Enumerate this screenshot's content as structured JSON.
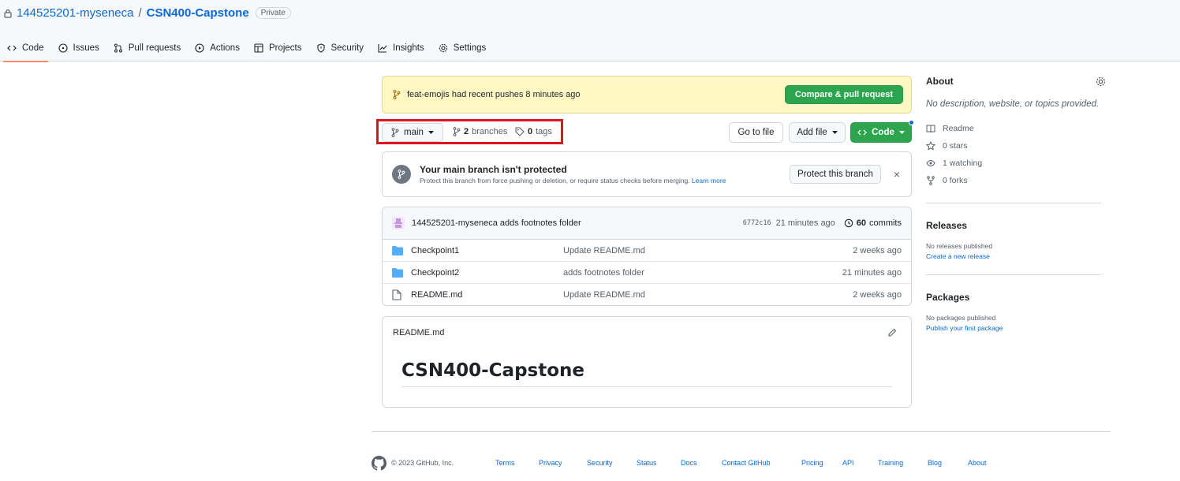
{
  "repo": {
    "owner": "144525201-myseneca",
    "separator": "/",
    "name": "CSN400-Capstone",
    "visibility": "Private"
  },
  "tabs": [
    {
      "label": "Code",
      "icon": "code-icon",
      "active": true
    },
    {
      "label": "Issues",
      "icon": "issue-icon"
    },
    {
      "label": "Pull requests",
      "icon": "pull-request-icon"
    },
    {
      "label": "Actions",
      "icon": "play-icon"
    },
    {
      "label": "Projects",
      "icon": "table-icon"
    },
    {
      "label": "Security",
      "icon": "shield-icon"
    },
    {
      "label": "Insights",
      "icon": "graph-icon"
    },
    {
      "label": "Settings",
      "icon": "gear-icon"
    }
  ],
  "flash": {
    "branch": "feat-emojis",
    "message": "had recent pushes 8 minutes ago",
    "button": "Compare & pull request"
  },
  "branch_bar": {
    "current_branch": "main",
    "branches_count": "2",
    "branches_label": "branches",
    "tags_count": "0",
    "tags_label": "tags",
    "goto_file": "Go to file",
    "add_file": "Add file",
    "code": "Code"
  },
  "protect": {
    "title": "Your main branch isn't protected",
    "subtitle": "Protect this branch from force pushing or deletion, or require status checks before merging.",
    "learn_more": "Learn more",
    "button": "Protect this branch",
    "close": "×"
  },
  "latest_commit": {
    "message": "144525201-myseneca adds footnotes folder",
    "sha": "6772c16",
    "time": "21 minutes ago",
    "commits_count": "60",
    "commits_label": "commits"
  },
  "files": [
    {
      "name": "Checkpoint1",
      "type": "folder",
      "message": "Update README.md",
      "age": "2 weeks ago"
    },
    {
      "name": "Checkpoint2",
      "type": "folder",
      "message": "adds footnotes folder",
      "age": "21 minutes ago"
    },
    {
      "name": "README.md",
      "type": "file",
      "message": "Update README.md",
      "age": "2 weeks ago"
    }
  ],
  "readme": {
    "filename": "README.md",
    "heading": "CSN400-Capstone"
  },
  "about": {
    "title": "About",
    "description": "No description, website, or topics provided.",
    "items": [
      {
        "icon": "book-icon",
        "label": "Readme"
      },
      {
        "icon": "star-icon",
        "label": "0 stars"
      },
      {
        "icon": "eye-icon",
        "label": "1 watching"
      },
      {
        "icon": "fork-icon",
        "label": "0 forks"
      }
    ]
  },
  "releases": {
    "title": "Releases",
    "empty": "No releases published",
    "link": "Create a new release"
  },
  "packages": {
    "title": "Packages",
    "empty": "No packages published",
    "link": "Publish your first package"
  },
  "footer": {
    "copyright": "© 2023 GitHub, Inc.",
    "links": [
      "Terms",
      "Privacy",
      "Security",
      "Status",
      "Docs",
      "Contact GitHub",
      "Pricing",
      "API",
      "Training",
      "Blog",
      "About"
    ]
  },
  "colors": {
    "link": "#0969da",
    "green": "#2da44e",
    "flash_bg": "#fff8c5",
    "highlight_box": "#e0131e",
    "active_tab": "#fd8c73"
  }
}
